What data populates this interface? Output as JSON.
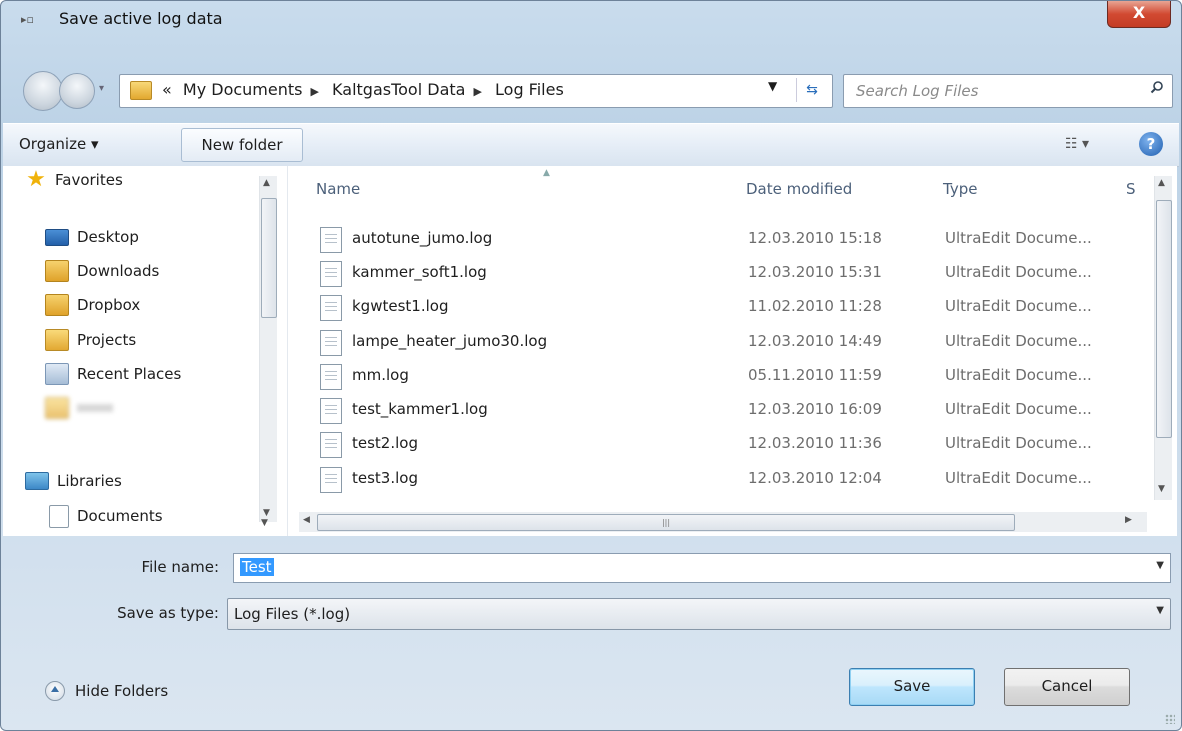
{
  "window": {
    "title": "Save active log data",
    "close_label": "X"
  },
  "address_bar": {
    "overflow": "«",
    "breadcrumbs": [
      "My Documents",
      "KaltgasTool Data",
      "Log Files"
    ]
  },
  "search": {
    "placeholder": "Search Log Files"
  },
  "toolbar": {
    "organize_label": "Organize ▾",
    "new_folder_label": "New folder"
  },
  "nav_pane": {
    "favorites_label": "Favorites",
    "items": [
      {
        "label": "Desktop",
        "icon": "desktop-icon"
      },
      {
        "label": "Downloads",
        "icon": "downloads-folder-icon"
      },
      {
        "label": "Dropbox",
        "icon": "dropbox-folder-icon"
      },
      {
        "label": "Projects",
        "icon": "folder-icon"
      },
      {
        "label": "Recent Places",
        "icon": "recent-places-icon"
      }
    ],
    "libraries_label": "Libraries",
    "library_items": [
      {
        "label": "Documents",
        "icon": "documents-icon"
      }
    ]
  },
  "file_list": {
    "columns": [
      "Name",
      "Date modified",
      "Type",
      "S"
    ],
    "rows": [
      {
        "name": "autotune_jumo.log",
        "date": "12.03.2010 15:18",
        "type": "UltraEdit Docume..."
      },
      {
        "name": "kammer_soft1.log",
        "date": "12.03.2010 15:31",
        "type": "UltraEdit Docume..."
      },
      {
        "name": "kgwtest1.log",
        "date": "11.02.2010 11:28",
        "type": "UltraEdit Docume..."
      },
      {
        "name": "lampe_heater_jumo30.log",
        "date": "12.03.2010 14:49",
        "type": "UltraEdit Docume..."
      },
      {
        "name": "mm.log",
        "date": "05.11.2010 11:59",
        "type": "UltraEdit Docume..."
      },
      {
        "name": "test_kammer1.log",
        "date": "12.03.2010 16:09",
        "type": "UltraEdit Docume..."
      },
      {
        "name": "test2.log",
        "date": "12.03.2010 11:36",
        "type": "UltraEdit Docume..."
      },
      {
        "name": "test3.log",
        "date": "12.03.2010 12:04",
        "type": "UltraEdit Docume..."
      }
    ]
  },
  "form": {
    "file_name_label": "File name:",
    "file_name_value": "Test",
    "save_type_label": "Save as type:",
    "save_type_value": "Log Files (*.log)"
  },
  "footer": {
    "hide_folders_label": "Hide Folders",
    "save_label": "Save",
    "cancel_label": "Cancel"
  },
  "colors": {
    "accent": "#3399ff",
    "close": "#d24a32",
    "frame": "#bcd2e6"
  }
}
